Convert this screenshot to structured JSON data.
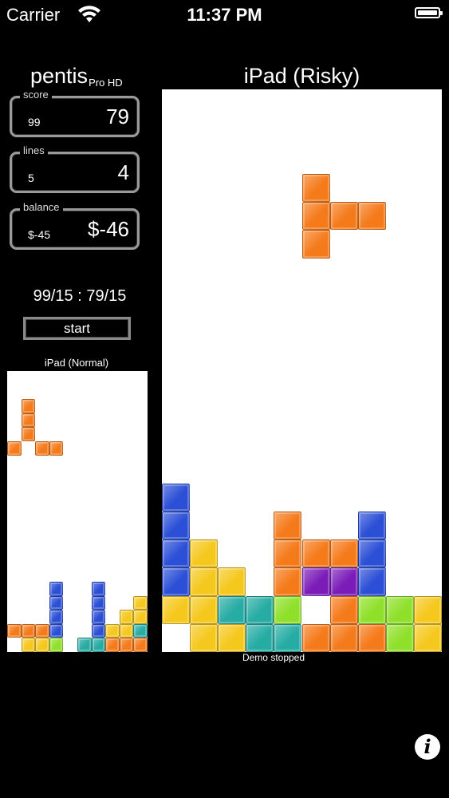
{
  "status_bar": {
    "carrier": "Carrier",
    "time": "11:37 PM"
  },
  "app": {
    "title": "pentis",
    "subtitle": "Pro HD"
  },
  "stats": {
    "score": {
      "label": "score",
      "secondary": "99",
      "primary": "79"
    },
    "lines": {
      "label": "lines",
      "secondary": "5",
      "primary": "4"
    },
    "balance": {
      "label": "balance",
      "secondary": "$-45",
      "primary": "$-46"
    }
  },
  "ratio_text": "99/15 : 79/15",
  "start_button": "start",
  "mini_board": {
    "label": "iPad (Normal)",
    "cols": 10,
    "rows": 20,
    "cells": [
      [
        1,
        2,
        "orange"
      ],
      [
        1,
        3,
        "orange"
      ],
      [
        1,
        4,
        "orange"
      ],
      [
        0,
        5,
        "orange"
      ],
      [
        2,
        5,
        "orange"
      ],
      [
        3,
        5,
        "orange"
      ],
      [
        3,
        15,
        "blue"
      ],
      [
        3,
        16,
        "blue"
      ],
      [
        3,
        17,
        "blue"
      ],
      [
        3,
        18,
        "blue"
      ],
      [
        6,
        15,
        "blue"
      ],
      [
        6,
        16,
        "blue"
      ],
      [
        6,
        17,
        "blue"
      ],
      [
        6,
        18,
        "blue"
      ],
      [
        9,
        16,
        "yellow"
      ],
      [
        8,
        17,
        "yellow"
      ],
      [
        9,
        17,
        "yellow"
      ],
      [
        7,
        18,
        "yellow"
      ],
      [
        8,
        18,
        "yellow"
      ],
      [
        9,
        18,
        "teal"
      ],
      [
        0,
        18,
        "orange"
      ],
      [
        1,
        18,
        "orange"
      ],
      [
        2,
        18,
        "orange"
      ],
      [
        1,
        19,
        "yellow"
      ],
      [
        2,
        19,
        "yellow"
      ],
      [
        3,
        19,
        "green"
      ],
      [
        5,
        19,
        "teal"
      ],
      [
        6,
        19,
        "teal"
      ],
      [
        7,
        19,
        "orange"
      ],
      [
        8,
        19,
        "orange"
      ],
      [
        9,
        19,
        "orange"
      ]
    ]
  },
  "main_board": {
    "label": "iPad (Risky)",
    "cols": 10,
    "rows": 20,
    "cells": [
      [
        5,
        3,
        "orange"
      ],
      [
        5,
        4,
        "orange"
      ],
      [
        6,
        4,
        "orange"
      ],
      [
        7,
        4,
        "orange"
      ],
      [
        5,
        5,
        "orange"
      ],
      [
        0,
        14,
        "blue"
      ],
      [
        0,
        15,
        "blue"
      ],
      [
        0,
        16,
        "blue"
      ],
      [
        0,
        17,
        "blue"
      ],
      [
        1,
        16,
        "yellow"
      ],
      [
        1,
        17,
        "yellow"
      ],
      [
        2,
        17,
        "yellow"
      ],
      [
        4,
        15,
        "orange"
      ],
      [
        4,
        16,
        "orange"
      ],
      [
        5,
        16,
        "orange"
      ],
      [
        6,
        16,
        "orange"
      ],
      [
        4,
        17,
        "orange"
      ],
      [
        5,
        17,
        "purple"
      ],
      [
        6,
        17,
        "purple"
      ],
      [
        7,
        15,
        "blue"
      ],
      [
        7,
        16,
        "blue"
      ],
      [
        7,
        17,
        "blue"
      ],
      [
        0,
        18,
        "yellow"
      ],
      [
        1,
        18,
        "yellow"
      ],
      [
        2,
        18,
        "teal"
      ],
      [
        3,
        18,
        "teal"
      ],
      [
        4,
        18,
        "green"
      ],
      [
        6,
        18,
        "orange"
      ],
      [
        7,
        18,
        "green"
      ],
      [
        8,
        18,
        "green"
      ],
      [
        9,
        18,
        "yellow"
      ],
      [
        1,
        19,
        "yellow"
      ],
      [
        2,
        19,
        "yellow"
      ],
      [
        3,
        19,
        "teal"
      ],
      [
        4,
        19,
        "teal"
      ],
      [
        5,
        19,
        "orange"
      ],
      [
        6,
        19,
        "orange"
      ],
      [
        7,
        19,
        "orange"
      ],
      [
        8,
        19,
        "green"
      ],
      [
        9,
        19,
        "yellow"
      ]
    ]
  },
  "colors": {
    "orange": "#f57a1a",
    "blue": "#2b4fd6",
    "yellow": "#f5c81e",
    "teal": "#27aca4",
    "green": "#8fe02a",
    "purple": "#7b1cb8"
  },
  "demo_status": "Demo stopped",
  "icons": {
    "wifi": "wifi-icon",
    "battery": "battery-icon",
    "info": "info-icon"
  }
}
